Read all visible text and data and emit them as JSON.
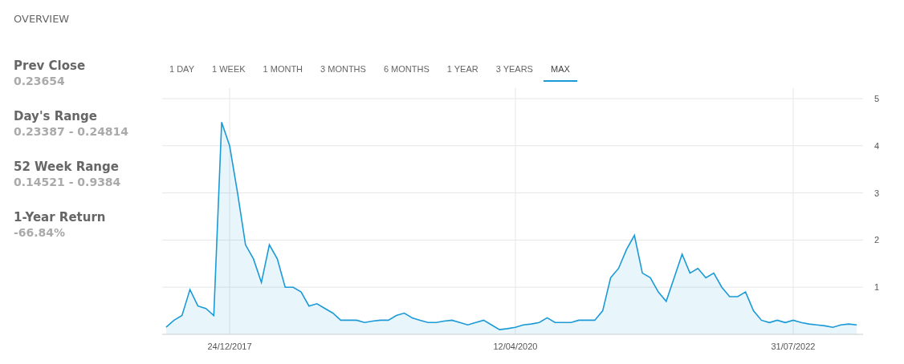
{
  "title": "OVERVIEW",
  "stats": [
    {
      "label": "Prev Close",
      "value": "0.23654"
    },
    {
      "label": "Day's Range",
      "value": "0.23387 - 0.24814"
    },
    {
      "label": "52 Week Range",
      "value": "0.14521 - 0.9384"
    },
    {
      "label": "1-Year Return",
      "value": "-66.84%"
    }
  ],
  "tabs": [
    {
      "label": "1 DAY",
      "selected": false
    },
    {
      "label": "1 WEEK",
      "selected": false
    },
    {
      "label": "1 MONTH",
      "selected": false
    },
    {
      "label": "3 MONTHS",
      "selected": false
    },
    {
      "label": "6 MONTHS",
      "selected": false
    },
    {
      "label": "1 YEAR",
      "selected": false
    },
    {
      "label": "3 YEARS",
      "selected": false
    },
    {
      "label": "MAX",
      "selected": true
    }
  ],
  "chart_data": {
    "type": "area",
    "grid": true,
    "ylim": [
      0,
      5
    ],
    "yticks": [
      1,
      2,
      3,
      4,
      5
    ],
    "categories": [
      null,
      null,
      null,
      null,
      null,
      null,
      null,
      null,
      "24/12/2017",
      null,
      null,
      null,
      null,
      null,
      null,
      null,
      null,
      null,
      null,
      null,
      null,
      null,
      null,
      null,
      null,
      null,
      null,
      null,
      null,
      null,
      null,
      null,
      null,
      null,
      null,
      null,
      null,
      null,
      null,
      null,
      null,
      null,
      null,
      null,
      "12/04/2020",
      null,
      null,
      null,
      null,
      null,
      null,
      null,
      null,
      null,
      null,
      null,
      null,
      null,
      null,
      null,
      null,
      null,
      null,
      null,
      null,
      null,
      null,
      null,
      null,
      null,
      null,
      null,
      null,
      null,
      null,
      null,
      null,
      null,
      null,
      "31/07/2022",
      null,
      null,
      null,
      null,
      null,
      null,
      null,
      null
    ],
    "series": [
      {
        "color": "#1a9ad6",
        "values": [
          0.15,
          0.3,
          0.4,
          0.95,
          0.6,
          0.55,
          0.4,
          4.5,
          4.0,
          3.0,
          1.9,
          1.6,
          1.1,
          1.9,
          1.6,
          1.0,
          1.0,
          0.9,
          0.6,
          0.65,
          0.55,
          0.45,
          0.3,
          0.3,
          0.3,
          0.25,
          0.28,
          0.3,
          0.3,
          0.4,
          0.45,
          0.35,
          0.3,
          0.25,
          0.25,
          0.28,
          0.3,
          0.25,
          0.2,
          0.25,
          0.3,
          0.2,
          0.1,
          0.12,
          0.15,
          0.2,
          0.22,
          0.25,
          0.35,
          0.25,
          0.25,
          0.25,
          0.3,
          0.3,
          0.3,
          0.5,
          1.2,
          1.4,
          1.8,
          2.1,
          1.3,
          1.2,
          0.9,
          0.7,
          1.2,
          1.7,
          1.3,
          1.4,
          1.2,
          1.3,
          1.0,
          0.8,
          0.8,
          0.9,
          0.5,
          0.3,
          0.25,
          0.3,
          0.25,
          0.3,
          0.25,
          0.22,
          0.2,
          0.18,
          0.15,
          0.2,
          0.22,
          0.2
        ]
      }
    ]
  }
}
